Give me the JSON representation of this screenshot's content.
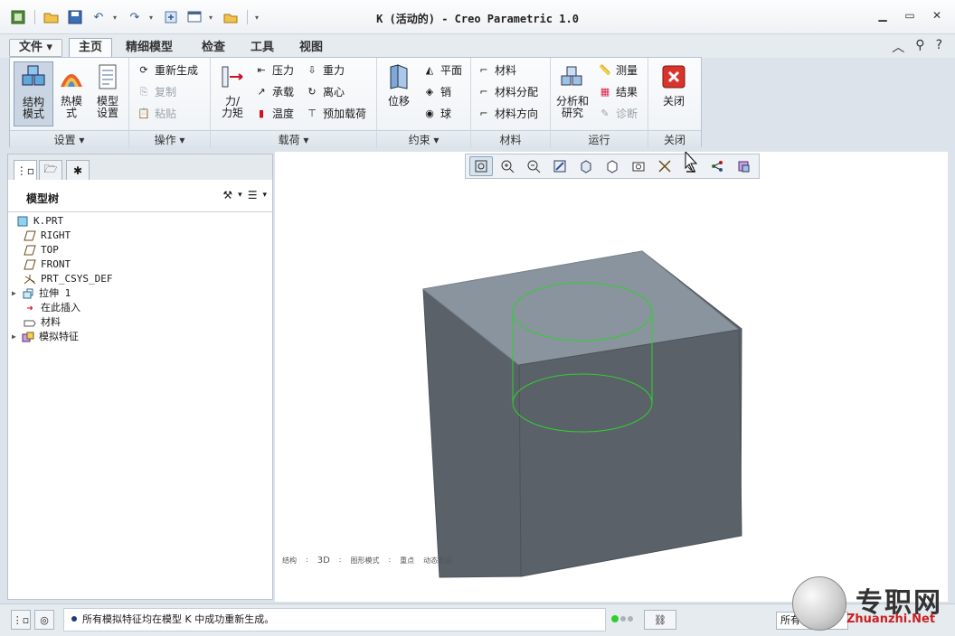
{
  "window": {
    "title": "K (活动的) - Creo Parametric 1.0",
    "minimize_icon": "minimize-icon",
    "restore_icon": "restore-icon",
    "close_icon": "close-icon"
  },
  "menu_tabs": [
    "文件",
    "主页",
    "精细模型",
    "检查",
    "工具",
    "视图"
  ],
  "active_tab": "主页",
  "ribbon": {
    "groups": {
      "setup": "设置",
      "operations": "操作",
      "loads": "载荷",
      "constraints": "约束",
      "material": "材料",
      "run": "运行",
      "close": "关闭"
    },
    "buttons": {
      "structure_mode": "结构模式",
      "structure_mode_l1": "结构",
      "structure_mode_l2": "模式",
      "thermal_mode_l1": "热模",
      "thermal_mode_l2": "式",
      "model_setup_l1": "模型",
      "model_setup_l2": "设置",
      "regenerate": "重新生成",
      "copy": "复制",
      "paste": "粘贴",
      "force_moment_l1": "力/",
      "force_moment_l2": "力矩",
      "pressure": "压力",
      "bearing": "承载",
      "temperature": "温度",
      "gravity": "重力",
      "centrifugal": "离心",
      "preload": "预加载荷",
      "displacement": "位移",
      "planar": "平面",
      "pin": "销",
      "ball": "球",
      "material": "材料",
      "material_assignment": "材料分配",
      "material_orientation": "材料方向",
      "analysis_l1": "分析和",
      "analysis_l2": "研究",
      "measure": "测量",
      "results": "结果",
      "diagnostics": "诊断",
      "close": "关闭"
    }
  },
  "model_tree": {
    "title": "模型树",
    "items": [
      {
        "label": "K.PRT",
        "icon": "part-icon"
      },
      {
        "label": "RIGHT",
        "icon": "datum-plane-icon"
      },
      {
        "label": "TOP",
        "icon": "datum-plane-icon"
      },
      {
        "label": "FRONT",
        "icon": "datum-plane-icon"
      },
      {
        "label": "PRT_CSYS_DEF",
        "icon": "csys-icon"
      },
      {
        "label": "拉伸 1",
        "icon": "extrude-icon"
      },
      {
        "label": "在此插入",
        "icon": "insert-here-icon"
      },
      {
        "label": "材料",
        "icon": "material-icon"
      },
      {
        "label": "模拟特征",
        "icon": "simulation-features-icon"
      }
    ]
  },
  "graphics": {
    "status_text": [
      "结构",
      "3D",
      "图形模式",
      "重点",
      "动态表面"
    ]
  },
  "status_bar": {
    "message": "所有模拟特征均在模型 K 中成功重新生成。",
    "filter": "所有"
  },
  "watermark": {
    "cn": "专职网",
    "en": "Zhuanzhi.Net"
  },
  "colors": {
    "accent": "#2b6cb0",
    "model_side": "#5b6169",
    "model_top": "#8a949e",
    "sketch_green": "#2fcf2f"
  }
}
